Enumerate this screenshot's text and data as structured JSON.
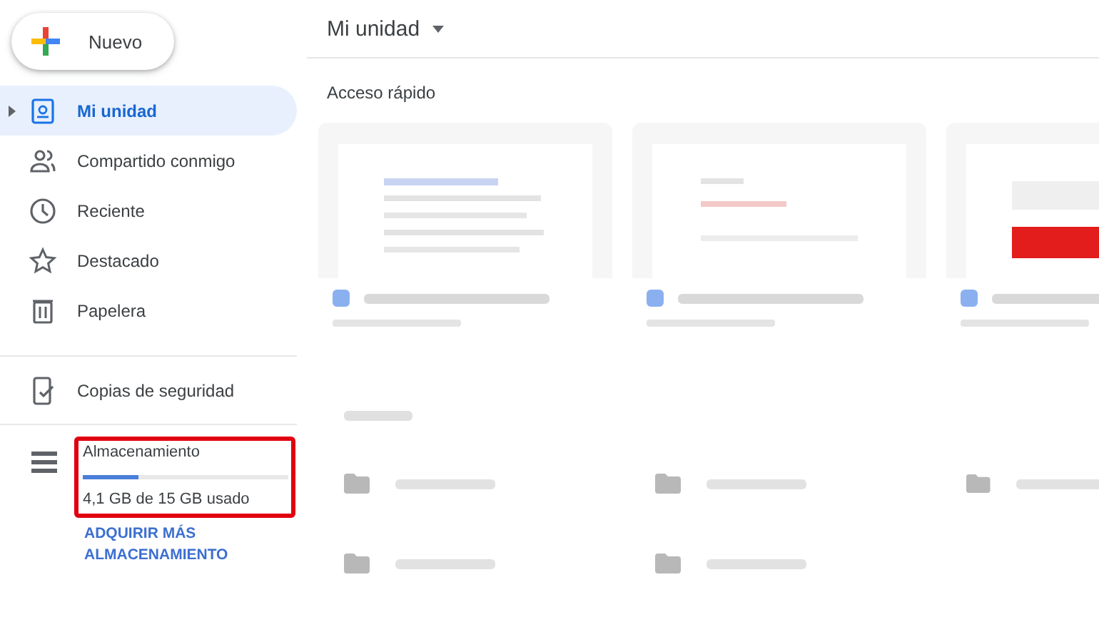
{
  "new_button": {
    "label": "Nuevo"
  },
  "nav": [
    [
      {
        "kind": "drive",
        "label": "Mi unidad",
        "selected": true,
        "expandable": true
      },
      {
        "kind": "shared",
        "label": "Compartido conmigo",
        "selected": false,
        "expandable": false
      },
      {
        "kind": "recent",
        "label": "Reciente",
        "selected": false,
        "expandable": false
      },
      {
        "kind": "starred",
        "label": "Destacado",
        "selected": false,
        "expandable": false
      },
      {
        "kind": "trash",
        "label": "Papelera",
        "selected": false,
        "expandable": false
      }
    ],
    [
      {
        "kind": "backup",
        "label": "Copias de seguridad",
        "selected": false,
        "expandable": false
      }
    ]
  ],
  "storage": {
    "title": "Almacenamiento",
    "level": 0.27,
    "usage": "4,1 GB de 15 GB usado",
    "highlighted": true,
    "link": "ADQUIRIR MÁS ALMACENAMIENTO"
  },
  "main": {
    "title": "Mi unidad",
    "quick_access": {
      "title": "Acceso rápido",
      "cards": [
        {
          "kind": "doc"
        },
        {
          "kind": "form"
        },
        {
          "kind": "banner"
        }
      ]
    },
    "folders": [
      {
        "kind": "folder"
      },
      {
        "kind": "folder"
      },
      {
        "kind": "folder"
      },
      {
        "kind": "folder"
      },
      {
        "kind": "folder"
      }
    ]
  }
}
